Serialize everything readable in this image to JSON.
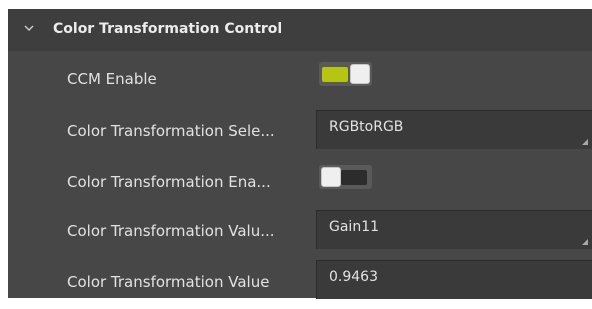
{
  "section": {
    "title": "Color Transformation Control",
    "expand_icon": "chevron-down-icon"
  },
  "rows": [
    {
      "label": "CCM Enable",
      "control": "toggle",
      "state": "on"
    },
    {
      "label": "Color Transformation Sele...",
      "control": "dropdown",
      "value": "RGBtoRGB"
    },
    {
      "label": "Color Transformation Ena...",
      "control": "toggle",
      "state": "off"
    },
    {
      "label": "Color Transformation Valu...",
      "control": "dropdown",
      "value": "Gain11"
    },
    {
      "label": "Color Transformation Value",
      "control": "text-input",
      "value": "0.9463"
    }
  ],
  "colors": {
    "panel_bg": "#474747",
    "header_bg": "#3e3e3e",
    "field_bg": "#3a3a3a",
    "toggle_on_accent": "#b5c511",
    "text": "#e2e2e2"
  }
}
